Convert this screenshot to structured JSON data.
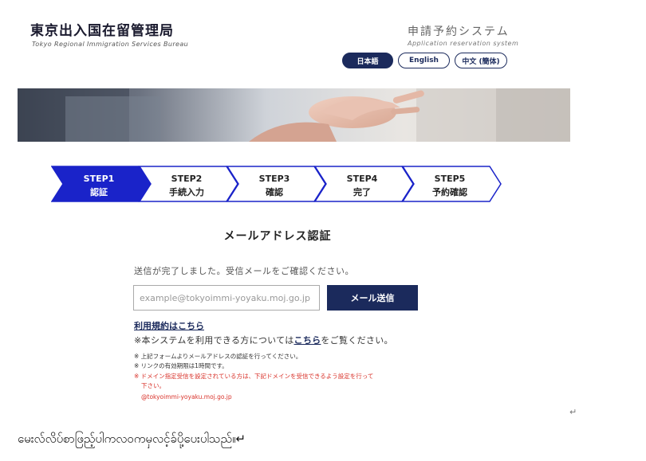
{
  "header": {
    "org_name_jp": "東京出入国在留管理局",
    "org_name_en": "Tokyo Regional Immigration Services Bureau",
    "system_name_jp": "申請予約システム",
    "system_name_en": "Application reservation system",
    "languages": [
      {
        "label": "日本語",
        "active": true
      },
      {
        "label": "English",
        "active": false
      },
      {
        "label": "中文 (簡体)",
        "active": false
      }
    ]
  },
  "steps": [
    {
      "label": "STEP1",
      "sub": "認証",
      "active": true
    },
    {
      "label": "STEP2",
      "sub": "手続入力",
      "active": false
    },
    {
      "label": "STEP3",
      "sub": "確認",
      "active": false
    },
    {
      "label": "STEP4",
      "sub": "完了",
      "active": false
    },
    {
      "label": "STEP5",
      "sub": "予約確認",
      "active": false
    }
  ],
  "form": {
    "title": "メールアドレス認証",
    "sent_message": "送信が完了しました。受信メールをご確認ください。",
    "email_placeholder": "example@tokyoimmi-yoyaku.moj.go.jp",
    "send_button": "メール送信",
    "terms_link": "利用規約はこちら",
    "system_note_prefix": "※本システムを利用できる方については",
    "system_note_link": "こちら",
    "system_note_suffix": "をご覧ください。"
  },
  "notes": {
    "note1": "※ 上記フォームよりメールアドレスの認証を行ってください。",
    "note2": "※ リンクの有効期限は1時間です。",
    "note3_line1": "※ ドメイン指定受信を設定されている方は、下記ドメインを受信できるよう設定を行って",
    "note3_line2": "下さい。",
    "domain": "@tokyoimmi-yoyaku.moj.go.jp"
  },
  "doc": {
    "return_mark1": "↵",
    "burmese_text": "မေးလ်လိပ်စာဖြည့်ပါကလဝကမှလင့်ခ်ပို့ပေးပါသည်။↵"
  },
  "colors": {
    "navy": "#1b2a5c",
    "step_active_fill": "#1a23c9",
    "step_border": "#1a23c9",
    "note_red": "#d9332b"
  }
}
